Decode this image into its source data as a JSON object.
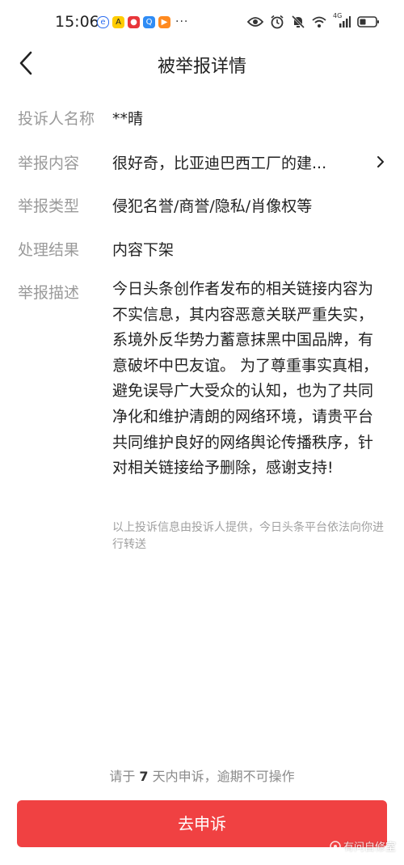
{
  "status_bar": {
    "time": "15:06",
    "network_label": "4G",
    "more_indicator": "···"
  },
  "header": {
    "title": "被举报详情"
  },
  "details": {
    "complainant": {
      "label": "投诉人名称",
      "value": "**晴"
    },
    "content": {
      "label": "举报内容",
      "value": "很好奇，比亚迪巴西工厂的建..."
    },
    "type": {
      "label": "举报类型",
      "value": "侵犯名誉/商誉/隐私/肖像权等"
    },
    "result": {
      "label": "处理结果",
      "value": "内容下架"
    },
    "description": {
      "label": "举报描述",
      "value": "今日头条创作者发布的相关链接内容为不实信息，其内容恶意关联严重失实，系境外反华势力蓄意抹黑中国品牌，有意破坏中巴友谊。 为了尊重事实真相，避免误导广大受众的认知，也为了共同净化和维护清朗的网络环境，请贵平台共同维护良好的网络舆论传播秩序，针对相关链接给予删除，感谢支持!",
      "note": "以上投诉信息由投诉人提供，今日头条平台依法向你进行转送"
    }
  },
  "appeal": {
    "hint_prefix": "请于",
    "hint_days": "7",
    "hint_suffix": "天内申诉，逾期不可操作",
    "button_label": "去申诉"
  },
  "watermark": {
    "text": "有问自修室"
  },
  "colors": {
    "accent": "#f04142",
    "label_gray": "#9a9a9a"
  }
}
